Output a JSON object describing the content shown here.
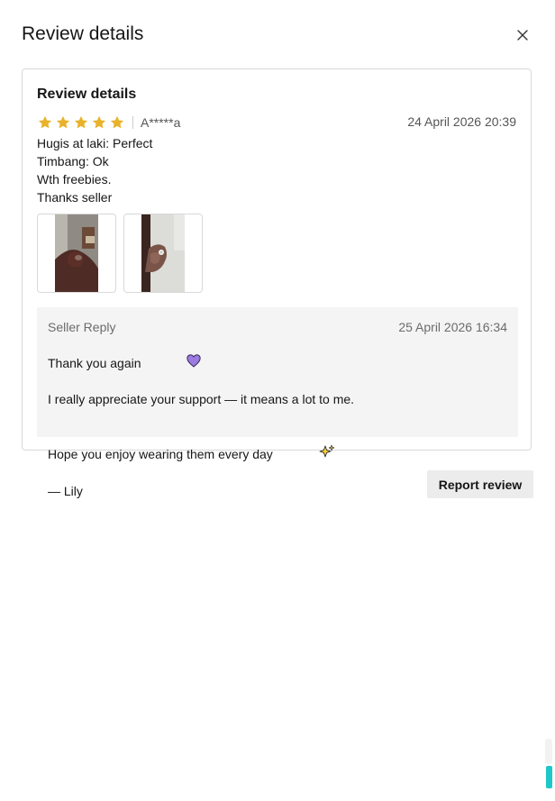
{
  "dialog": {
    "title": "Review details",
    "close_icon": "close-icon"
  },
  "review": {
    "heading": "Review details",
    "rating": 5,
    "rating_max": 5,
    "star_color": "#f0b429",
    "reviewer": "A*****a",
    "date": "24 April 2026 20:39",
    "lines": [
      "Hugis at laki: Perfect",
      "Timbang: Ok",
      "Wth freebies.",
      "Thanks seller"
    ],
    "photos": [
      "review-photo-1",
      "review-photo-2"
    ]
  },
  "seller_reply": {
    "label": "Seller Reply",
    "date": "25 April 2026 16:34",
    "lines": [
      "Thank you again",
      "I really appreciate your support — it means a lot to me.",
      "",
      "Hope you enjoy wearing them every day",
      "— Lily"
    ],
    "emojis": [
      "purple-heart-icon",
      "sparkles-icon"
    ]
  },
  "actions": {
    "report_label": "Report review"
  },
  "colors": {
    "accent_scroll": "#1ec8c8",
    "reply_bg": "#f4f4f4"
  }
}
